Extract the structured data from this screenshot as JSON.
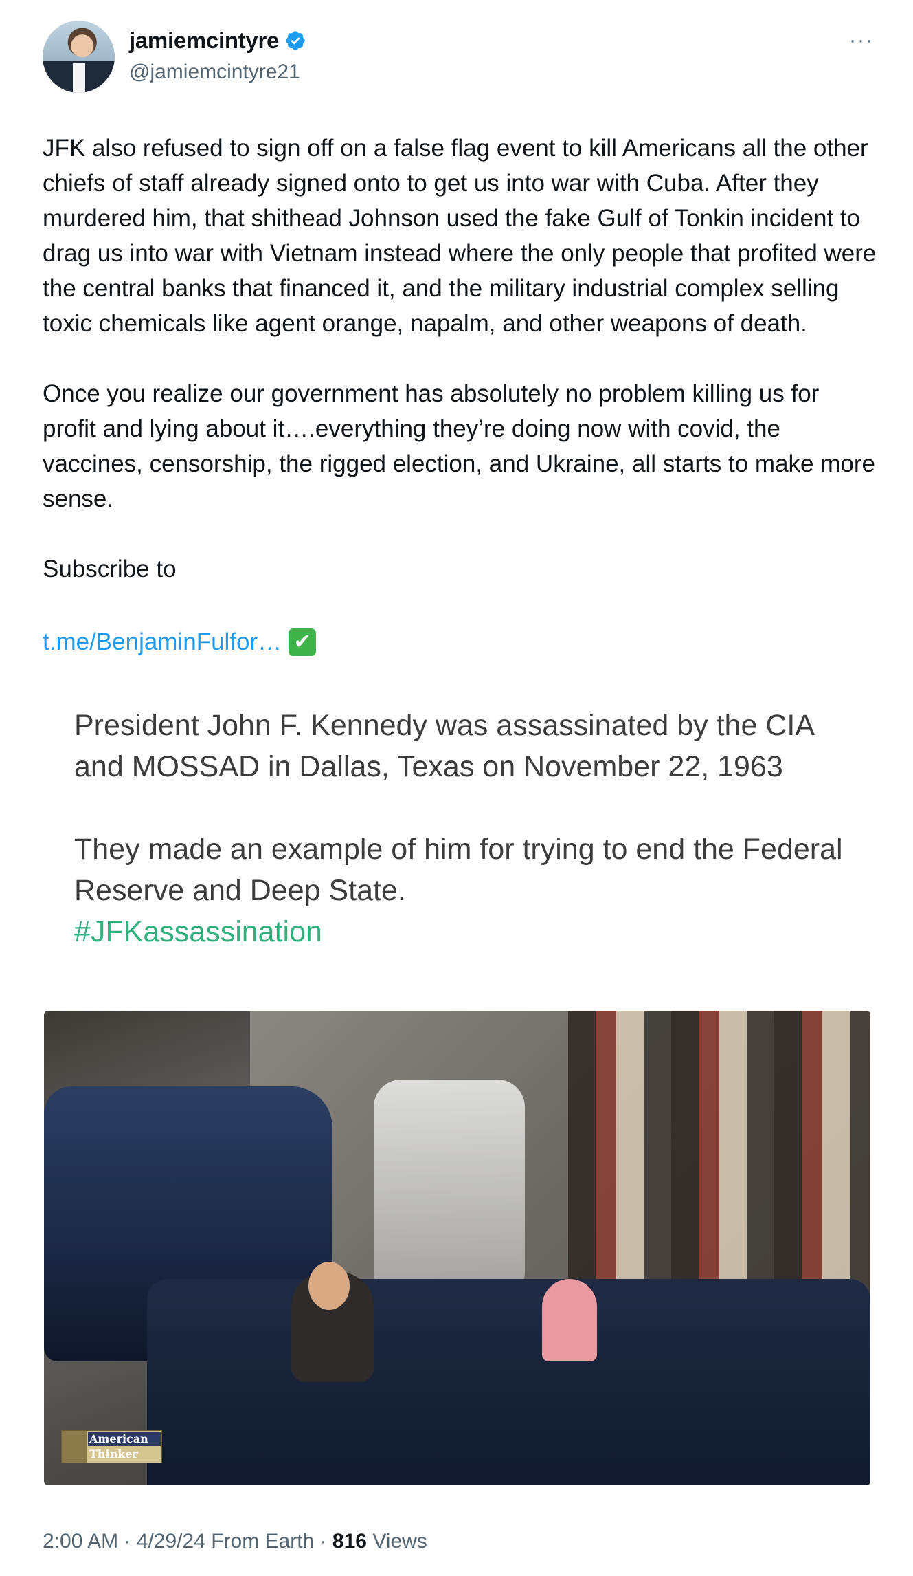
{
  "author": {
    "name": "jamiemcintyre",
    "handle": "@jamiemcintyre21",
    "verified": true,
    "more_label": "···"
  },
  "tweet": {
    "text": "JFK also refused to sign off on a false flag event to kill Americans all the other chiefs of staff already signed onto to get us into war with Cuba. After they murdered him, that shithead Johnson used the fake Gulf of Tonkin incident to drag us into war with Vietnam instead where the only people that profited were the central banks that financed it, and the military industrial complex selling toxic chemicals like agent orange, napalm, and other weapons of death.\n\nOnce you realize our government has absolutely no problem killing us for profit and lying about it….everything they’re doing now with covid, the vaccines, censorship, the rigged election, and Ukraine, all starts to make more sense.\n\nSubscribe to",
    "link": "t.me/BenjaminFulfor…",
    "link_emoji": "✔"
  },
  "media": {
    "paragraph1": "President John F. Kennedy was assassinated by the CIA and MOSSAD in Dallas, Texas on November 22, 1963",
    "paragraph2": "They made an example of him for trying to end the Federal Reserve and Deep State.",
    "hashtag": "#JFKassassination",
    "watermark_line1": "American",
    "watermark_line2": "Thinker"
  },
  "meta": {
    "time": "2:00 AM",
    "date": "4/29/24",
    "source": "From Earth",
    "views_count": "816",
    "views_label": "Views",
    "separator": "·"
  },
  "colors": {
    "link": "#1d9bf0",
    "verified": "#1d9bf0",
    "hashtag": "#2fb07d",
    "secondary_text": "#536471"
  }
}
